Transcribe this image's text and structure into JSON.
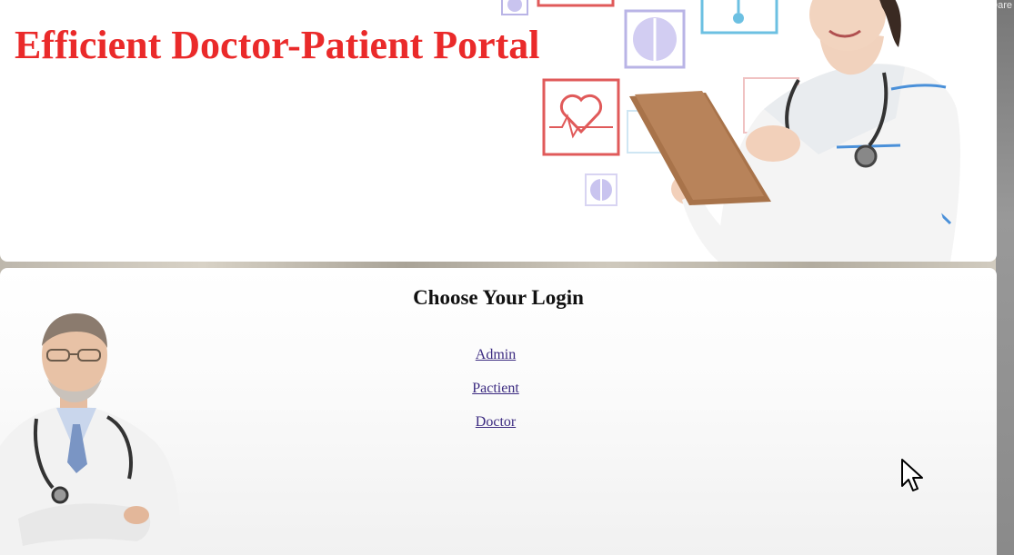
{
  "corner_text": "Dare",
  "header": {
    "title": "Efficient Doctor-Patient Portal",
    "title_color": "#ea2a2a",
    "hero_image": "nurse-with-tablet-and-medical-icons"
  },
  "login": {
    "heading": "Choose Your Login",
    "links": [
      {
        "label": "Admin"
      },
      {
        "label": "Pactient"
      },
      {
        "label": "Doctor"
      }
    ],
    "side_image": "senior-doctor-with-stethoscope"
  },
  "colors": {
    "link": "#3b2a80",
    "icon_red": "#e05a5a",
    "icon_blue": "#5aa9d6",
    "icon_violet": "#8f86d6"
  }
}
